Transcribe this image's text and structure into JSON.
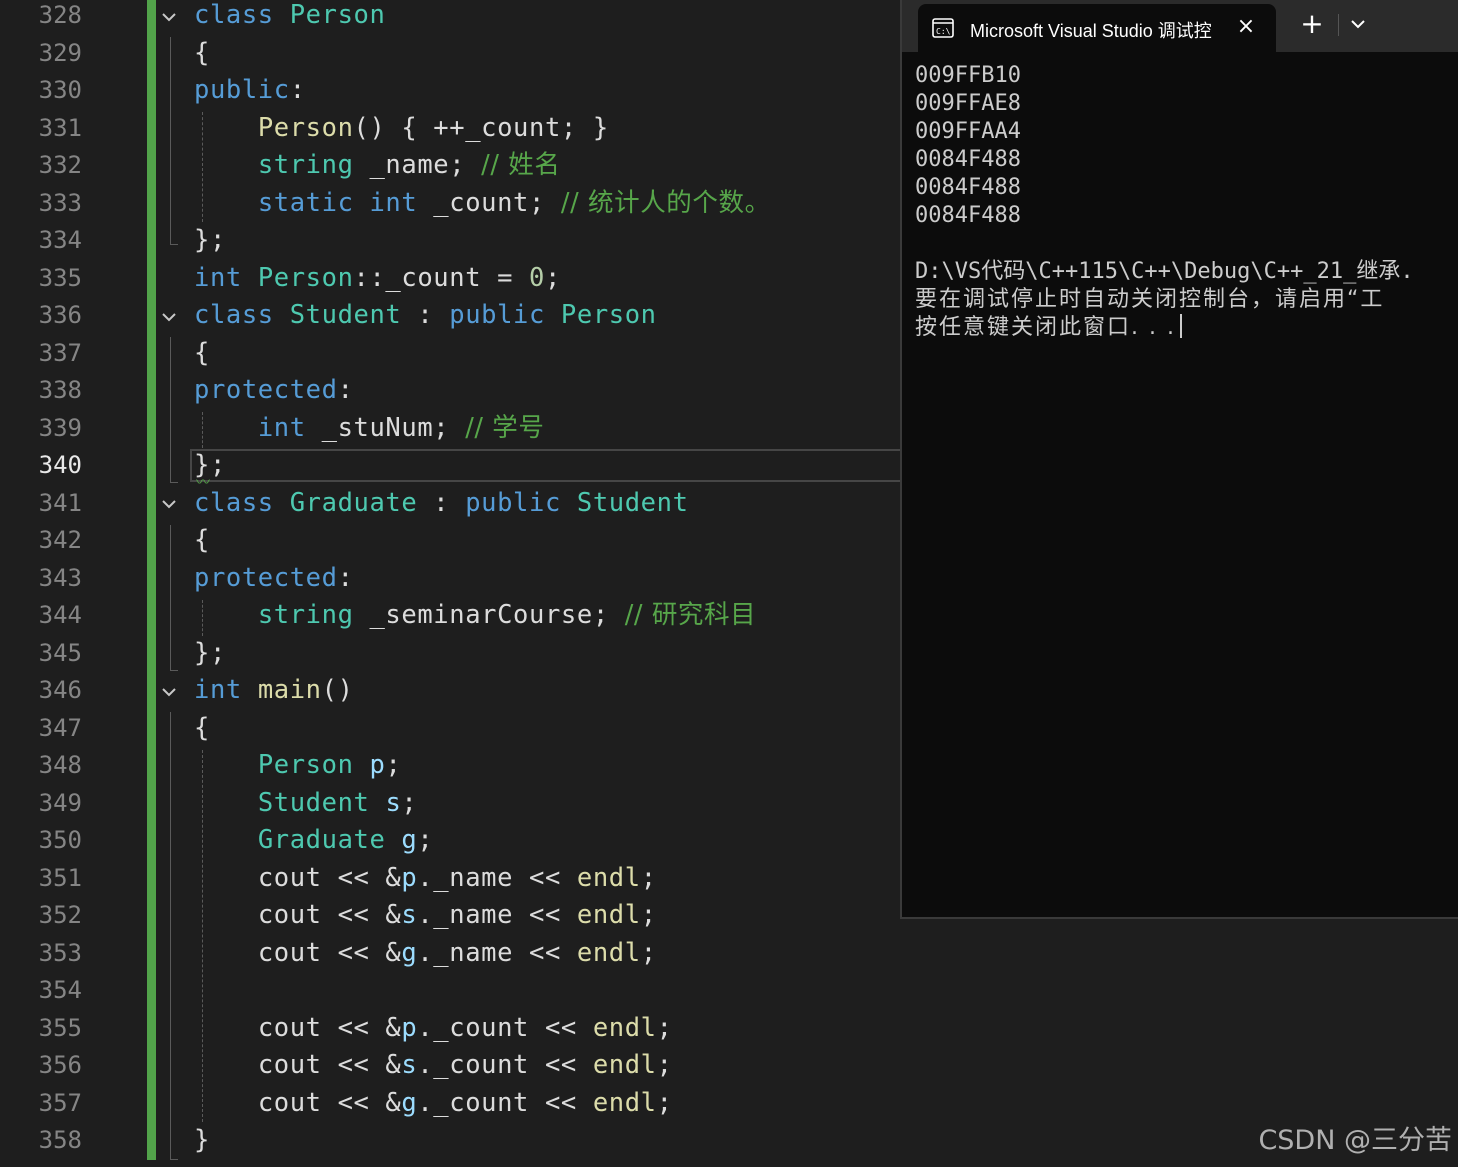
{
  "editor": {
    "line_numbers": [
      "328",
      "329",
      "330",
      "331",
      "332",
      "333",
      "334",
      "335",
      "336",
      "337",
      "338",
      "339",
      "340",
      "341",
      "342",
      "343",
      "344",
      "345",
      "346",
      "347",
      "348",
      "349",
      "350",
      "351",
      "352",
      "353",
      "354",
      "355",
      "356",
      "357",
      "358"
    ],
    "active_line": "340",
    "code": {
      "l328": {
        "kw": "class",
        "ty": "Person"
      },
      "l329": {
        "p": "{"
      },
      "l330": {
        "kw": "public",
        "p": ":"
      },
      "l331": {
        "fn": "Person",
        "p": "() { ++_count; }"
      },
      "l332": {
        "ty": "string",
        "p": "_name;",
        "cm": "// 姓名"
      },
      "l333": {
        "kw1": "static",
        "kw2": "int",
        "p": "_count;",
        "cm": "// 统计人的个数。"
      },
      "l334": {
        "p": "};"
      },
      "l335": {
        "kw": "int",
        "ty": "Person",
        "p1": "::_count = ",
        "nm": "0",
        "p2": ";"
      },
      "l336": {
        "kw": "class",
        "ty": "Student",
        "p": " : ",
        "kw2": "public",
        "ty2": "Person"
      },
      "l337": {
        "p": "{"
      },
      "l338": {
        "kw": "protected",
        "p": ":"
      },
      "l339": {
        "kw": "int",
        "p": "_stuNum;",
        "cm": "// 学号"
      },
      "l340": {
        "p": "};"
      },
      "l341": {
        "kw": "class",
        "ty": "Graduate",
        "p": " : ",
        "kw2": "public",
        "ty2": "Student"
      },
      "l342": {
        "p": "{"
      },
      "l343": {
        "kw": "protected",
        "p": ":"
      },
      "l344": {
        "ty": "string",
        "p": "_seminarCourse;",
        "cm": "// 研究科目"
      },
      "l345": {
        "p": "};"
      },
      "l346": {
        "kw": "int",
        "fn": "main",
        "p": "()"
      },
      "l347": {
        "p": "{"
      },
      "l348": {
        "ty": "Person",
        "va": "p",
        "p": ";"
      },
      "l349": {
        "ty": "Student",
        "va": "s",
        "p": ";"
      },
      "l350": {
        "ty": "Graduate",
        "va": "g",
        "p": ";"
      },
      "l351": {
        "p1": "cout << &",
        "va": "p",
        "p2": "._name << ",
        "fn": "endl",
        "p3": ";"
      },
      "l352": {
        "p1": "cout << &",
        "va": "s",
        "p2": "._name << ",
        "fn": "endl",
        "p3": ";"
      },
      "l353": {
        "p1": "cout << &",
        "va": "g",
        "p2": "._name << ",
        "fn": "endl",
        "p3": ";"
      },
      "l355": {
        "p1": "cout << &",
        "va": "p",
        "p2": "._count << ",
        "fn": "endl",
        "p3": ";"
      },
      "l356": {
        "p1": "cout << &",
        "va": "s",
        "p2": "._count << ",
        "fn": "endl",
        "p3": ";"
      },
      "l357": {
        "p1": "cout << &",
        "va": "g",
        "p2": "._count << ",
        "fn": "endl",
        "p3": ";"
      },
      "l358": {
        "p": "}"
      }
    }
  },
  "console": {
    "tab_title": "Microsoft Visual Studio 调试控",
    "icon": "console-icon",
    "new_tab_label": "+",
    "close_label": "×",
    "output": [
      "009FFB10",
      "009FFAE8",
      "009FFAA4",
      "0084F488",
      "0084F488",
      "0084F488"
    ],
    "path_line": "D:\\VS代码\\C++115\\C++\\Debug\\C++_21_继承.",
    "hint_line": "要在调试停止时自动关闭控制台，请启用“工",
    "press_key_line": "按任意键关闭此窗口. . ."
  },
  "watermark": "CSDN @三分苦",
  "colors": {
    "keyword": "#569cd6",
    "type": "#4ec9b0",
    "function": "#dcdcaa",
    "variable": "#9cdcfe",
    "comment": "#57a64a",
    "number": "#b5cea8",
    "change_bar": "#52a34a"
  }
}
